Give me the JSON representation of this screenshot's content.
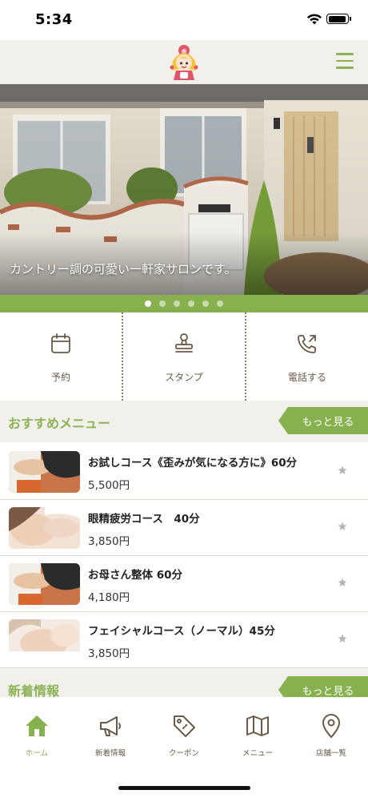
{
  "status_bar": {
    "time": "5:34"
  },
  "header": {
    "menu_icon": "hamburger-icon",
    "logo": "mascot-logo"
  },
  "hero": {
    "caption": "カントリー調の可愛い一軒家サロンです。",
    "slide_count": 6,
    "active_slide": 1
  },
  "quick_actions": [
    {
      "label": "予約",
      "icon": "calendar-icon"
    },
    {
      "label": "スタンプ",
      "icon": "stamp-icon"
    },
    {
      "label": "電話する",
      "icon": "phone-outgoing-icon"
    }
  ],
  "recommended": {
    "title": "おすすめメニュー",
    "more_label": "もっと見る",
    "items": [
      {
        "name": "お試しコース《歪みが気になる方に》60分",
        "price": "5,500円"
      },
      {
        "name": "眼精疲労コース　40分",
        "price": "3,850円"
      },
      {
        "name": "お母さん整体 60分",
        "price": "4,180円"
      },
      {
        "name": "フェイシャルコース（ノーマル）45分",
        "price": "3,850円"
      }
    ]
  },
  "news": {
    "title": "新着情報",
    "more_label": "もっと見る"
  },
  "bottom_nav": [
    {
      "label": "ホーム",
      "icon": "home-icon",
      "active": true
    },
    {
      "label": "新着情報",
      "icon": "megaphone-icon"
    },
    {
      "label": "クーポン",
      "icon": "coupon-tag-icon"
    },
    {
      "label": "メニュー",
      "icon": "map-icon"
    },
    {
      "label": "店舗一覧",
      "icon": "location-pin-icon"
    }
  ],
  "colors": {
    "accent": "#87b04f",
    "header_bg": "#f1f0ea",
    "icon_brown": "#6b5a47"
  }
}
